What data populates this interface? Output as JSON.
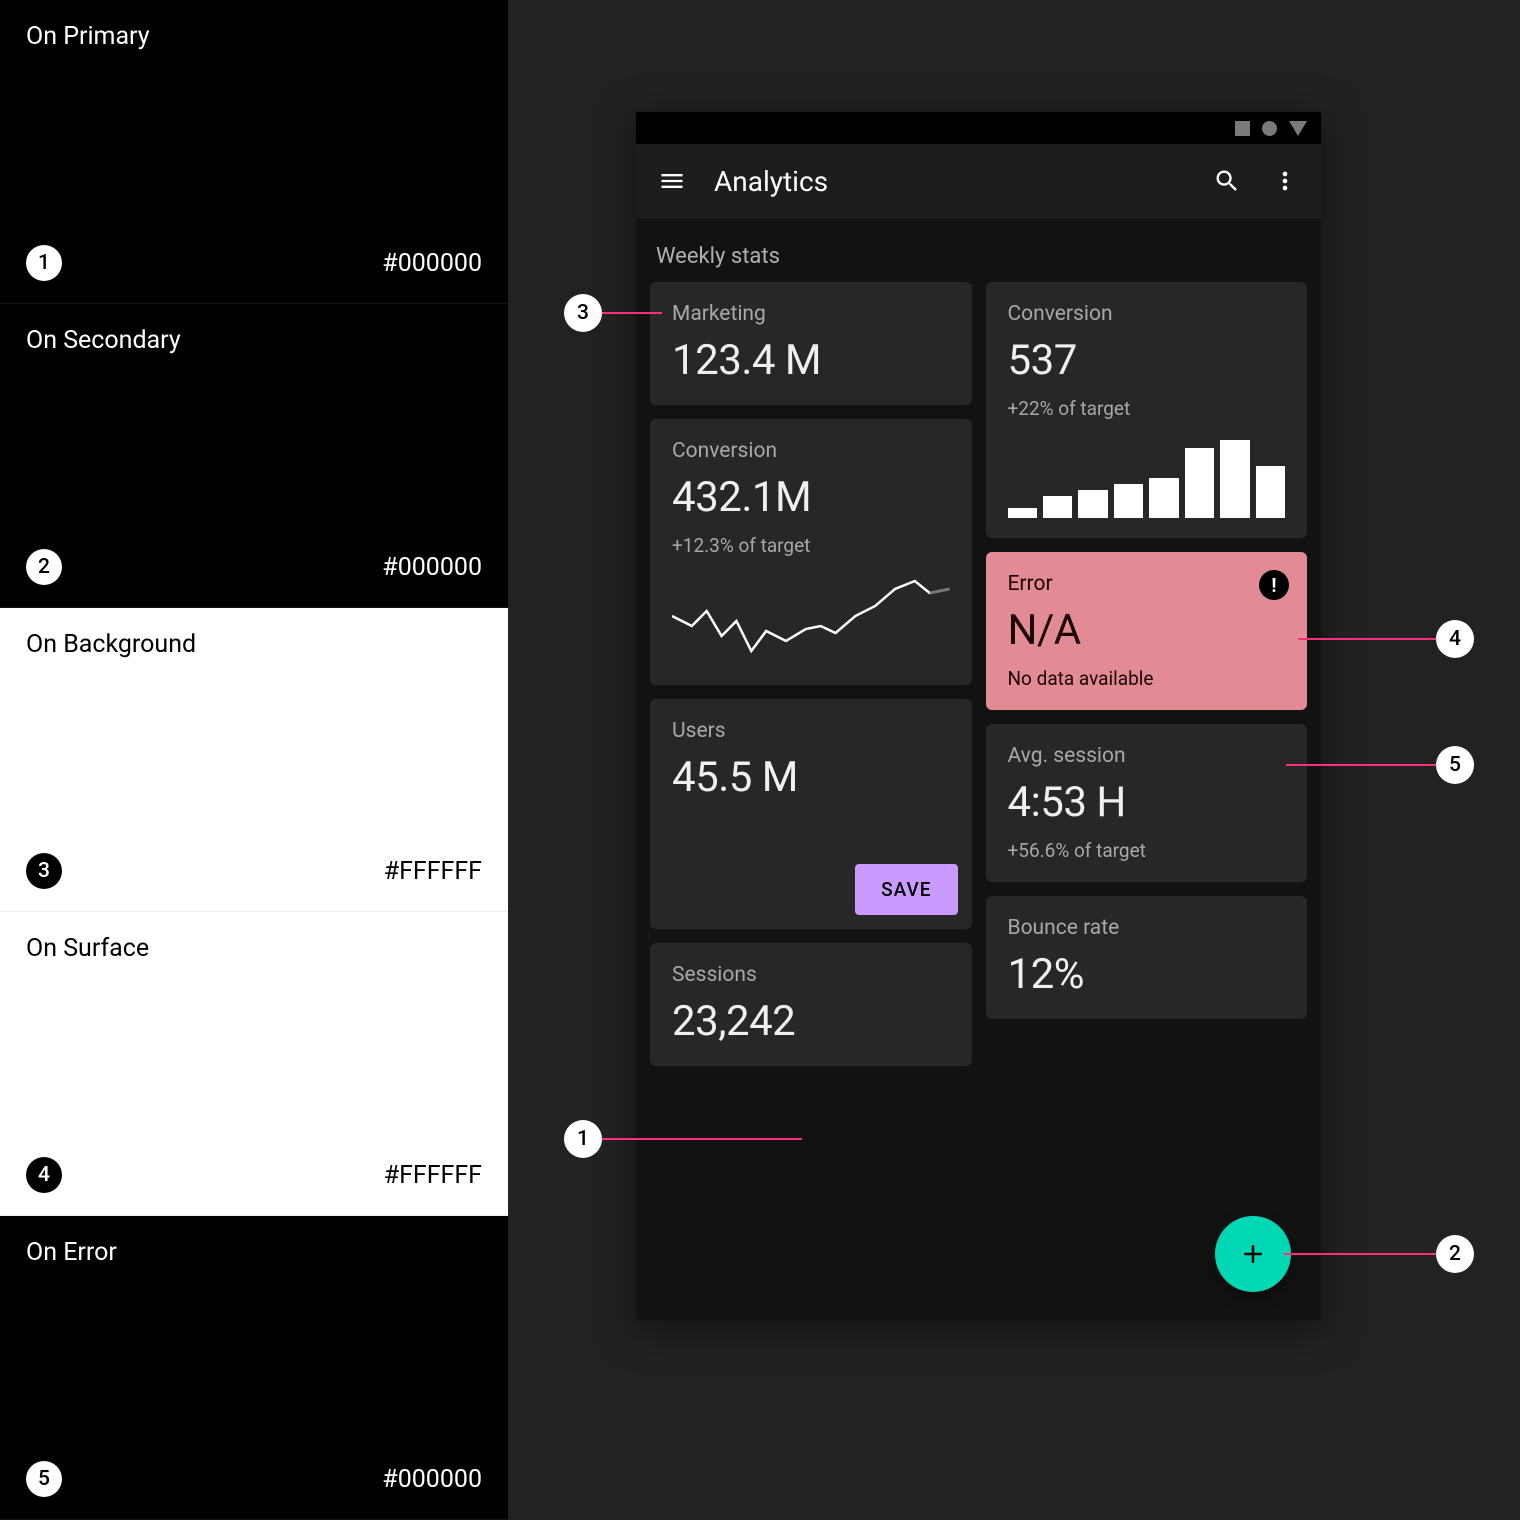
{
  "swatches": [
    {
      "title": "On Primary",
      "hex": "#000000",
      "num": "1",
      "mode": "dark"
    },
    {
      "title": "On Secondary",
      "hex": "#000000",
      "num": "2",
      "mode": "dark"
    },
    {
      "title": "On Background",
      "hex": "#FFFFFF",
      "num": "3",
      "mode": "light"
    },
    {
      "title": "On Surface",
      "hex": "#FFFFFF",
      "num": "4",
      "mode": "light"
    },
    {
      "title": "On Error",
      "hex": "#000000",
      "num": "5",
      "mode": "dark"
    }
  ],
  "app": {
    "title": "Analytics",
    "section_title": "Weekly stats",
    "save_label": "SAVE"
  },
  "cards": {
    "left": [
      {
        "label": "Marketing",
        "value": "123.4 M"
      },
      {
        "label": "Conversion",
        "value": "432.1M",
        "sub": "+12.3% of target",
        "spark": true
      },
      {
        "label": "Users",
        "value": "45.5 M",
        "has_save": true
      },
      {
        "label": "Sessions",
        "value": "23,242"
      }
    ],
    "right": [
      {
        "label": "Conversion",
        "value": "537",
        "sub": "+22% of target",
        "bars": true
      },
      {
        "label": "Error",
        "value": "N/A",
        "sub": "No data available",
        "error": true
      },
      {
        "label": "Avg. session",
        "value": "4:53 H",
        "sub": "+56.6% of target"
      },
      {
        "label": "Bounce rate",
        "value": "12%"
      }
    ]
  },
  "chart_data": {
    "type": "bar",
    "categories": [
      "1",
      "2",
      "3",
      "4",
      "5",
      "6",
      "7",
      "8"
    ],
    "values": [
      10,
      22,
      28,
      34,
      40,
      70,
      78,
      52
    ],
    "title": "Conversion bars",
    "xlabel": "",
    "ylabel": "",
    "ylim": [
      0,
      80
    ]
  },
  "callouts": {
    "c1": "1",
    "c2": "2",
    "c3": "3",
    "c4": "4",
    "c5": "5"
  },
  "colors": {
    "accent_purple": "#c99bff",
    "accent_teal": "#00d8b5",
    "error_surface": "#e38b94",
    "leader": "#ff2f7a"
  }
}
